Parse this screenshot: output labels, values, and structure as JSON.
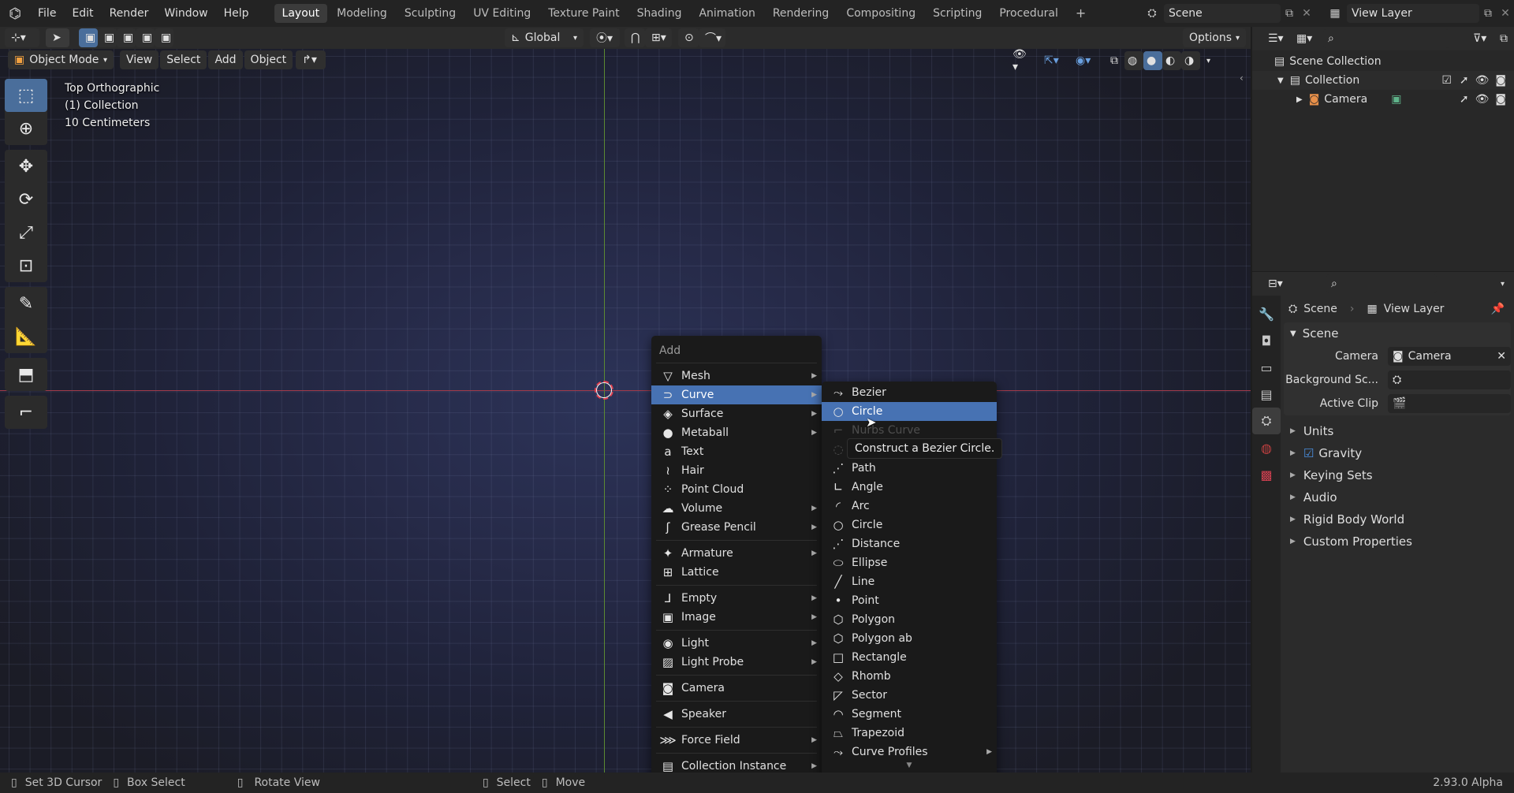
{
  "topbar": {
    "menus": [
      "File",
      "Edit",
      "Render",
      "Window",
      "Help"
    ],
    "workspaces": [
      "Layout",
      "Modeling",
      "Sculpting",
      "UV Editing",
      "Texture Paint",
      "Shading",
      "Animation",
      "Rendering",
      "Compositing",
      "Scripting",
      "Procedural"
    ],
    "active_workspace": "Layout",
    "scene": "Scene",
    "view_layer": "View Layer"
  },
  "header": {
    "transform_orientation": "Global",
    "options_label": "Options",
    "mode": "Object Mode",
    "view": "View",
    "select": "Select",
    "add": "Add",
    "object": "Object"
  },
  "viewport": {
    "view_name": "Top Orthographic",
    "collection": "(1) Collection",
    "scale": "10 Centimeters"
  },
  "add_menu": {
    "title": "Add",
    "items": [
      {
        "label": "Mesh",
        "icon": "▽",
        "submenu": true
      },
      {
        "label": "Curve",
        "icon": "⊃",
        "submenu": true
      },
      {
        "label": "Surface",
        "icon": "◈",
        "submenu": true
      },
      {
        "label": "Metaball",
        "icon": "●",
        "submenu": true
      },
      {
        "label": "Text",
        "icon": "a",
        "submenu": false
      },
      {
        "label": "Hair",
        "icon": "≀",
        "submenu": false
      },
      {
        "label": "Point Cloud",
        "icon": "⁘",
        "submenu": false
      },
      {
        "label": "Volume",
        "icon": "☁",
        "submenu": true
      },
      {
        "label": "Grease Pencil",
        "icon": "ʃ",
        "submenu": true
      },
      {
        "label": "Armature",
        "icon": "✦",
        "submenu": true
      },
      {
        "label": "Lattice",
        "icon": "⊞",
        "submenu": false
      },
      {
        "label": "Empty",
        "icon": "⅃",
        "submenu": true
      },
      {
        "label": "Image",
        "icon": "▣",
        "submenu": true
      },
      {
        "label": "Light",
        "icon": "◉",
        "submenu": true
      },
      {
        "label": "Light Probe",
        "icon": "▨",
        "submenu": true
      },
      {
        "label": "Camera",
        "icon": "◙",
        "submenu": false
      },
      {
        "label": "Speaker",
        "icon": "◀",
        "submenu": false
      },
      {
        "label": "Force Field",
        "icon": "⋙",
        "submenu": true
      },
      {
        "label": "Collection Instance",
        "icon": "▤",
        "submenu": true
      }
    ]
  },
  "curve_menu": {
    "items": [
      {
        "label": "Bezier",
        "icon": "⤳"
      },
      {
        "label": "Circle",
        "icon": "○"
      },
      {
        "label": "Nurbs Curve",
        "icon": "⌐"
      },
      {
        "label": "Nurbs Circle",
        "icon": "◌"
      },
      {
        "label": "Path",
        "icon": "⋰"
      },
      {
        "label": "Angle",
        "icon": "∟"
      },
      {
        "label": "Arc",
        "icon": "◜"
      },
      {
        "label": "Circle",
        "icon": "○"
      },
      {
        "label": "Distance",
        "icon": "⋰"
      },
      {
        "label": "Ellipse",
        "icon": "⬭"
      },
      {
        "label": "Line",
        "icon": "╱"
      },
      {
        "label": "Point",
        "icon": "•"
      },
      {
        "label": "Polygon",
        "icon": "⬡"
      },
      {
        "label": "Polygon ab",
        "icon": "⬡"
      },
      {
        "label": "Rectangle",
        "icon": "□"
      },
      {
        "label": "Rhomb",
        "icon": "◇"
      },
      {
        "label": "Sector",
        "icon": "◸"
      },
      {
        "label": "Segment",
        "icon": "◠"
      },
      {
        "label": "Trapezoid",
        "icon": "⏢"
      },
      {
        "label": "Curve Profiles",
        "icon": "⤳",
        "submenu": true
      }
    ],
    "tooltip": "Construct a Bezier Circle."
  },
  "outliner": {
    "scene_collection": "Scene Collection",
    "collection": "Collection",
    "camera": "Camera"
  },
  "properties": {
    "breadcrumb_scene": "Scene",
    "breadcrumb_layer": "View Layer",
    "panel_title": "Scene",
    "camera_label": "Camera",
    "camera_value": "Camera",
    "background_label": "Background Sc...",
    "active_clip_label": "Active Clip",
    "sections": [
      "Units",
      "Gravity",
      "Keying Sets",
      "Audio",
      "Rigid Body World",
      "Custom Properties"
    ]
  },
  "status": {
    "set_cursor": "Set 3D Cursor",
    "box_select": "Box Select",
    "rotate_view": "Rotate View",
    "select": "Select",
    "move": "Move",
    "version": "2.93.0 Alpha"
  }
}
